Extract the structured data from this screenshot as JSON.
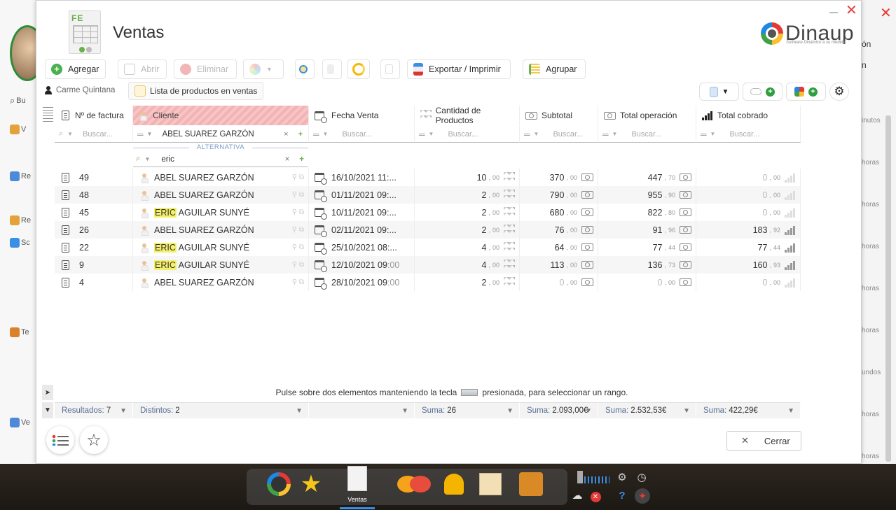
{
  "window": {
    "title": "Ventas",
    "brand": "Dinaup",
    "brand_tagline": "Software Dinámico a su medida",
    "close_glyph": "✕",
    "icon_letters": "FE"
  },
  "toolbar": {
    "add_label": "Agregar",
    "open_label": "Abrir",
    "delete_label": "Eliminar",
    "export_label": "Exportar / Imprimir",
    "group_label": "Agrupar"
  },
  "user": {
    "name": "Carme Quintana",
    "list_name": "Lista de productos en ventas"
  },
  "grid": {
    "columns": [
      {
        "label": "Nº de factura"
      },
      {
        "label": "Cliente"
      },
      {
        "label": "Fecha Venta"
      },
      {
        "label": "Cantidad de Productos"
      },
      {
        "label": "Subtotal"
      },
      {
        "label": "Total operación"
      },
      {
        "label": "Total cobrado"
      }
    ],
    "search_placeholder": "Buscar...",
    "client_filter_value": "ABEL SUAREZ GARZÓN",
    "alternative_label": "ALTERNATIVA",
    "alternative_filter_value": "eric",
    "rows": [
      {
        "invoice": "49",
        "client_hl": "",
        "client": "ABEL SUAREZ GARZÓN",
        "date": "16/10/2021 11:...",
        "date_tail": "",
        "qty": "10",
        "qty_dec": "00",
        "subtotal": "370",
        "subtotal_dec": "00",
        "total": "447",
        "total_dec": "70",
        "paid": "0",
        "paid_dec": "00",
        "paid_zero": true
      },
      {
        "invoice": "48",
        "client_hl": "",
        "client": "ABEL SUAREZ GARZÓN",
        "date": "01/11/2021 09:...",
        "date_tail": "",
        "qty": "2",
        "qty_dec": "00",
        "subtotal": "790",
        "subtotal_dec": "00",
        "total": "955",
        "total_dec": "90",
        "paid": "0",
        "paid_dec": "00",
        "paid_zero": true
      },
      {
        "invoice": "45",
        "client_hl": "ERIC",
        "client": " AGUILAR SUNYÉ",
        "date": "10/11/2021 09:...",
        "date_tail": "",
        "qty": "2",
        "qty_dec": "00",
        "subtotal": "680",
        "subtotal_dec": "00",
        "total": "822",
        "total_dec": "80",
        "paid": "0",
        "paid_dec": "00",
        "paid_zero": true
      },
      {
        "invoice": "26",
        "client_hl": "",
        "client": "ABEL SUAREZ GARZÓN",
        "date": "02/11/2021 09:...",
        "date_tail": "",
        "qty": "2",
        "qty_dec": "00",
        "subtotal": "76",
        "subtotal_dec": "00",
        "total": "91",
        "total_dec": "96",
        "paid": "183",
        "paid_dec": "92",
        "paid_zero": false
      },
      {
        "invoice": "22",
        "client_hl": "ERIC",
        "client": " AGUILAR SUNYÉ",
        "date": "25/10/2021 08:...",
        "date_tail": "",
        "qty": "4",
        "qty_dec": "00",
        "subtotal": "64",
        "subtotal_dec": "00",
        "total": "77",
        "total_dec": "44",
        "paid": "77",
        "paid_dec": "44",
        "paid_zero": false
      },
      {
        "invoice": "9",
        "client_hl": "ERIC",
        "client": " AGUILAR SUNYÉ",
        "date": "12/10/2021 09",
        "date_tail": ":00",
        "qty": "4",
        "qty_dec": "00",
        "subtotal": "113",
        "subtotal_dec": "00",
        "total": "136",
        "total_dec": "73",
        "paid": "160",
        "paid_dec": "93",
        "paid_zero": false
      },
      {
        "invoice": "4",
        "client_hl": "",
        "client": "ABEL SUAREZ GARZÓN",
        "date": "28/10/2021 09",
        "date_tail": ":00",
        "qty": "2",
        "qty_dec": "00",
        "subtotal": "0",
        "subtotal_dec": "00",
        "total": "0",
        "total_dec": "00",
        "paid": "0",
        "paid_dec": "00",
        "paid_zero": true
      }
    ]
  },
  "footer": {
    "hint_before": "Pulse sobre dos elementos manteniendo la tecla",
    "hint_after": "presionada, para seleccionar un rango.",
    "results_label": "Resultados:",
    "results_value": "7",
    "distinct_label": "Distintos:",
    "distinct_value": "2",
    "sum_label": "Suma:",
    "sum_qty": "26",
    "sum_subtotal": "2.093,00€",
    "sum_total": "2.532,53€",
    "sum_paid": "422,29€",
    "close_label": "Cerrar"
  },
  "background": {
    "left_search_prefix": "Bu",
    "left_items": [
      "V",
      "R",
      "Re",
      "Re",
      "Sc",
      "Te",
      "Ve"
    ],
    "right_texts": [
      "ón",
      "n",
      "inutos",
      "horas",
      "horas",
      "horas",
      "horas",
      "horas",
      "undos",
      "horas",
      "horas",
      "horas"
    ]
  },
  "taskbar": {
    "active_label": "Ventas"
  },
  "colors": {
    "accent_green": "#6ab04c",
    "close_red": "#e53a3a",
    "selected_header": "#f4bcbc",
    "highlight": "#f5f06a",
    "footer_label": "#5a6e95"
  }
}
